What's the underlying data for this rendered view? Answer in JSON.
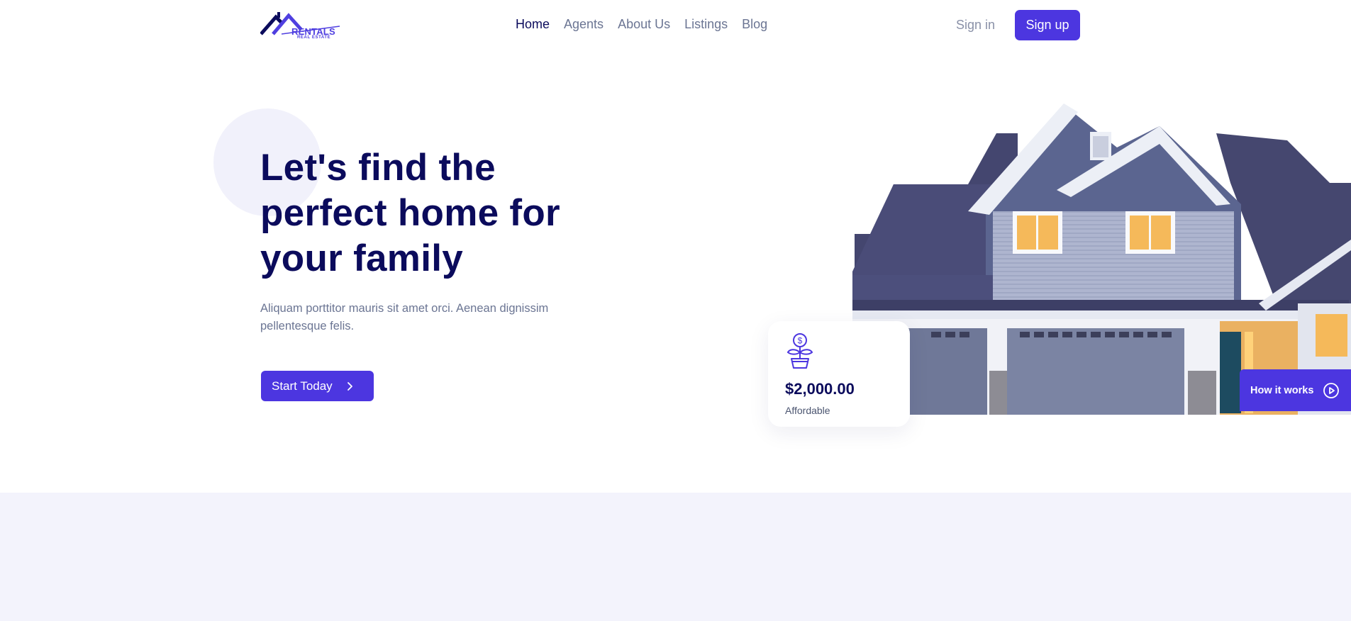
{
  "header": {
    "logo_text": "RENTALS",
    "logo_sub": "REAL ESTATE",
    "nav": [
      "Home",
      "Agents",
      "About Us",
      "Listings",
      "Blog"
    ],
    "active_nav": "Home",
    "signin_label": "Sign in",
    "signup_label": "Sign up"
  },
  "hero": {
    "title": "Let's find the perfect home for your family",
    "description": "Aliquam porttitor mauris sit amet orci. Aenean dignissim pellentesque felis.",
    "cta_label": "Start Today"
  },
  "price_card": {
    "value": "$2,000.00",
    "label": "Affordable",
    "icon": "money-plant-icon"
  },
  "how_it_works_label": "How it works",
  "colors": {
    "primary": "#4c36e0",
    "heading": "#0b0b5c",
    "muted": "#6b7593",
    "band": "#f3f3fc"
  }
}
